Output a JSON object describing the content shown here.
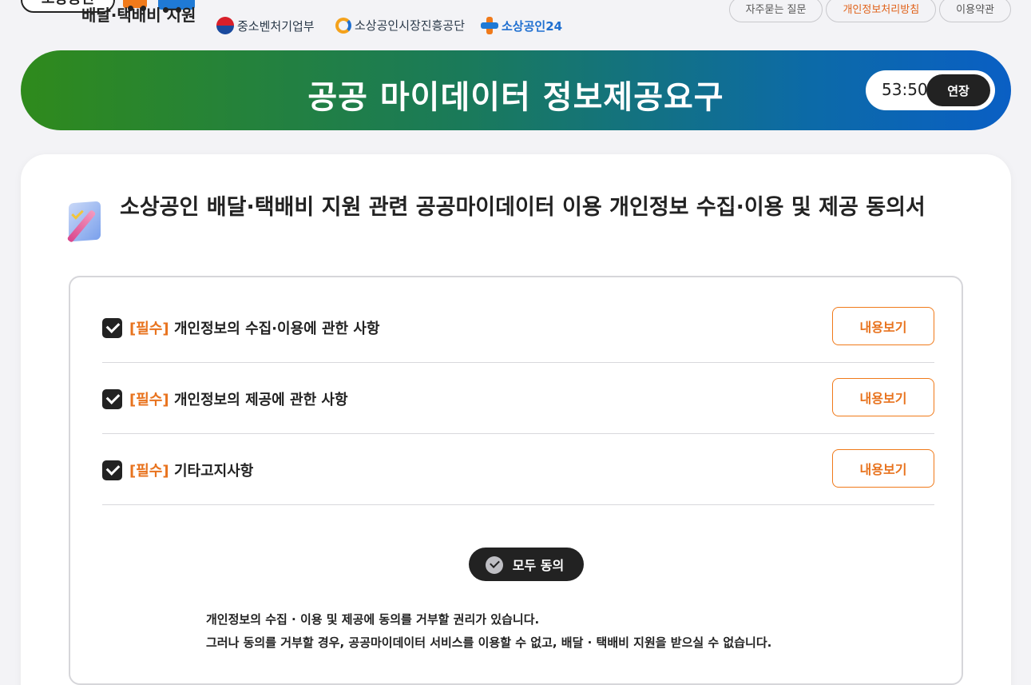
{
  "header": {
    "brand_top": "소상공인",
    "brand_title": "배달·택배비 지원",
    "orgs": [
      "중소벤처기업부",
      "소상공인시장진흥공단",
      "소상공인24"
    ],
    "links": [
      "자주묻는 질문",
      "개인정보처리방침",
      "이용약관"
    ]
  },
  "banner": {
    "title": "공공 마이데이터 정보제공요구",
    "timer": "53:50",
    "extend_label": "연장"
  },
  "card": {
    "title": "소상공인 배달·택배비 지원 관련 공공마이데이터 이용 개인정보 수집·이용 및 제공 동의서",
    "required_tag": "[필수]",
    "items": [
      {
        "label": "개인정보의 수집·이용에 관한 사항",
        "button": "내용보기",
        "checked": true
      },
      {
        "label": "개인정보의 제공에 관한 사항",
        "button": "내용보기",
        "checked": true
      },
      {
        "label": "기타고지사항",
        "button": "내용보기",
        "checked": true
      }
    ],
    "agree_all_label": "모두 동의",
    "notice_line1": "개인정보의 수집 · 이용 및 제공에 동의를 거부할 권리가 있습니다.",
    "notice_line2": "그러나 동의를 거부할 경우, 공공마이데이터 서비스를 이용할 수 없고, 배달 · 택배비 지원을 받으실 수 없습니다."
  },
  "colors": {
    "accent_orange": "#e8731e",
    "banner_green": "#2f8a1c",
    "banner_blue": "#0a5fc4",
    "dark": "#222222"
  }
}
